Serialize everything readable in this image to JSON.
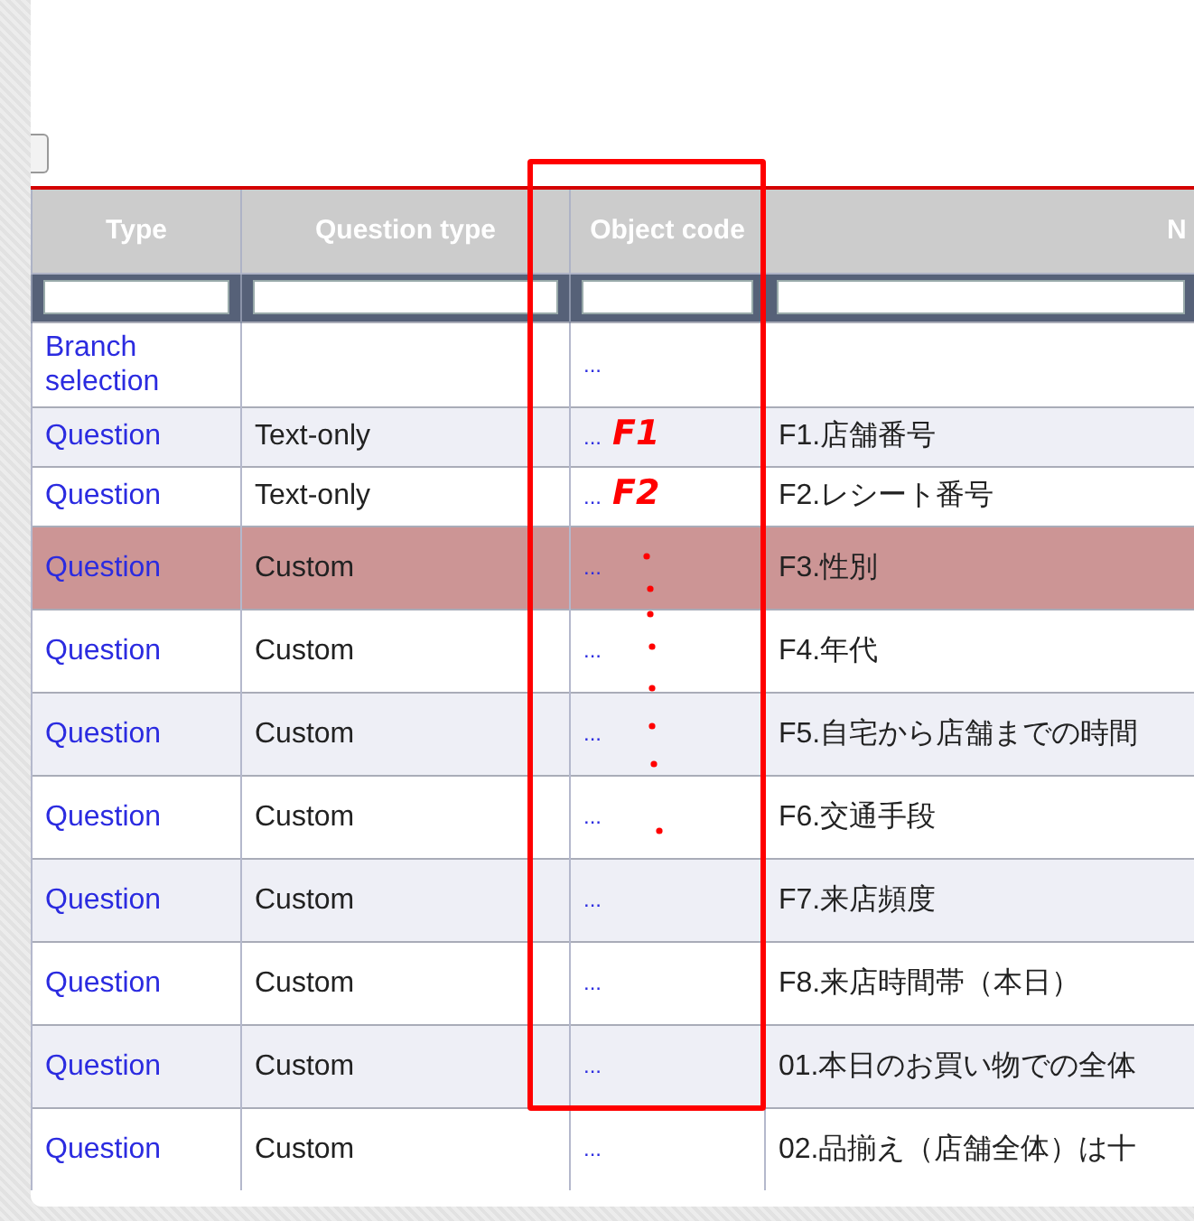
{
  "table": {
    "columns": [
      "Type",
      "Question type",
      "Object code",
      "N"
    ],
    "rows": [
      {
        "type": "Branch selection",
        "object_code": "...",
        "selected": false
      },
      {
        "type": "Question",
        "question_type": "Text-only",
        "object_code": "...",
        "annotation": "F1",
        "name": "F1.店舗番号",
        "selected": false
      },
      {
        "type": "Question",
        "question_type": "Text-only",
        "object_code": "...",
        "annotation": "F2",
        "name": "F2.レシート番号",
        "selected": false
      },
      {
        "type": "Question",
        "question_type": "Custom",
        "object_code": "...",
        "name": "F3.性別",
        "selected": true
      },
      {
        "type": "Question",
        "question_type": "Custom",
        "object_code": "...",
        "name": "F4.年代",
        "selected": false
      },
      {
        "type": "Question",
        "question_type": "Custom",
        "object_code": "...",
        "name": "F5.自宅から店舗までの時間",
        "selected": false
      },
      {
        "type": "Question",
        "question_type": "Custom",
        "object_code": "...",
        "name": "F6.交通手段",
        "selected": false
      },
      {
        "type": "Question",
        "question_type": "Custom",
        "object_code": "...",
        "name": "F7.来店頻度",
        "selected": false
      },
      {
        "type": "Question",
        "question_type": "Custom",
        "object_code": "...",
        "name": "F8.来店時間帯（本日）",
        "selected": false
      },
      {
        "type": "Question",
        "question_type": "Custom",
        "object_code": "...",
        "name": "01.本日のお買い物での全体",
        "selected": false
      },
      {
        "type": "Question",
        "question_type": "Custom",
        "object_code": "...",
        "name": "02.品揃え（店舗全体）は十",
        "selected": false
      }
    ]
  }
}
